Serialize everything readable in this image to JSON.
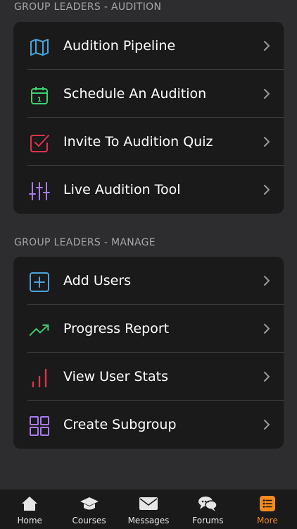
{
  "sections": [
    {
      "title": "GROUP LEADERS - AUDITION",
      "items": [
        {
          "label": "Audition Pipeline",
          "icon": "map-icon",
          "color": "#4aa3df"
        },
        {
          "label": "Schedule An Audition",
          "icon": "calendar-icon",
          "color": "#3ecf74"
        },
        {
          "label": "Invite To Audition Quiz",
          "icon": "checkbox-icon",
          "color": "#e0304f"
        },
        {
          "label": "Live Audition Tool",
          "icon": "sliders-icon",
          "color": "#a97bf0"
        }
      ]
    },
    {
      "title": "GROUP LEADERS - MANAGE",
      "items": [
        {
          "label": "Add Users",
          "icon": "plus-square-icon",
          "color": "#4aa3df"
        },
        {
          "label": "Progress Report",
          "icon": "trending-up-icon",
          "color": "#3ecf74"
        },
        {
          "label": "View User Stats",
          "icon": "bar-chart-icon",
          "color": "#e0304f"
        },
        {
          "label": "Create Subgroup",
          "icon": "grid-icon",
          "color": "#a97bf0"
        }
      ]
    }
  ],
  "calendar_day": "1",
  "tabs": [
    {
      "label": "Home",
      "icon": "home-icon"
    },
    {
      "label": "Courses",
      "icon": "graduation-cap-icon"
    },
    {
      "label": "Messages",
      "icon": "envelope-icon"
    },
    {
      "label": "Forums",
      "icon": "chat-bubbles-icon"
    },
    {
      "label": "More",
      "icon": "list-icon",
      "active": true
    }
  ],
  "colors": {
    "background": "#2d2d30",
    "card": "#1a1a1a",
    "accent": "#f38a1e",
    "section_title": "#a6a6aa"
  }
}
